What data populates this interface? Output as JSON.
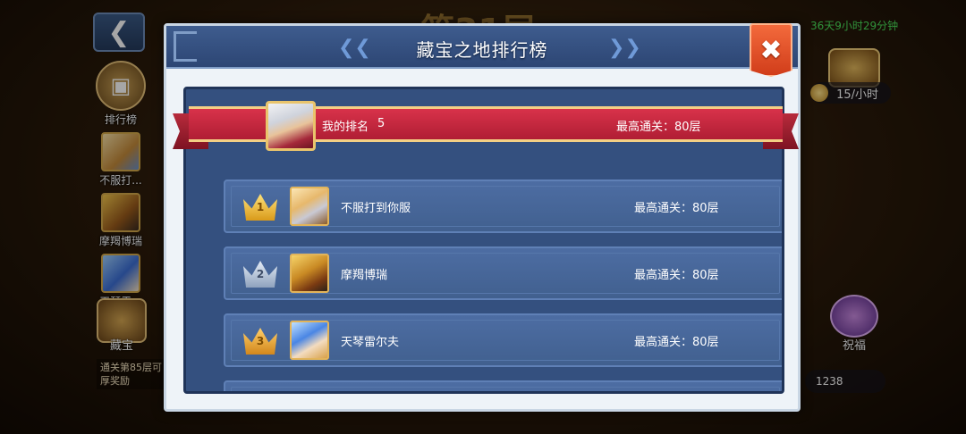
{
  "background": {
    "back_icon": "chevron-left-icon",
    "floor_title": "第31层",
    "timer_label": "36天9小时29分钟",
    "side_menu": [
      {
        "label": "排行榜",
        "icon": "ranking-chest-icon"
      },
      {
        "label": "不服打...",
        "icon": "hero-avatar"
      },
      {
        "label": "摩羯博瑞",
        "icon": "hero-avatar"
      },
      {
        "label": "天琴雷...",
        "icon": "hero-avatar"
      },
      {
        "label": "藏宝",
        "icon": "treasure-chest-icon"
      }
    ],
    "note": "通关第85层可\n厚奖励",
    "rate": "15/小时",
    "bless_label": "祝福",
    "count": "1238"
  },
  "modal": {
    "title": "藏宝之地排行榜",
    "left_arrow_icon": "double-chevron-left-icon",
    "right_arrow_icon": "double-chevron-right-icon",
    "close_icon": "close-icon",
    "my_rank": {
      "label": "我的排名",
      "value": "5",
      "best": "最高通关：80层"
    },
    "rows": [
      {
        "rank": "1",
        "crown": "gold",
        "name": "不服打到你服",
        "best": "最高通关：80层"
      },
      {
        "rank": "2",
        "crown": "silver",
        "name": "摩羯博瑞",
        "best": "最高通关：80层"
      },
      {
        "rank": "3",
        "crown": "bronze",
        "name": "天琴雷尔夫",
        "best": "最高通关：80层"
      }
    ]
  },
  "colors": {
    "header": "#2d4674",
    "panel": "#34507f",
    "row": "#4d6da3",
    "ribbon": "#c52a40",
    "close": "#e0502a",
    "timer": "#4be05a"
  }
}
